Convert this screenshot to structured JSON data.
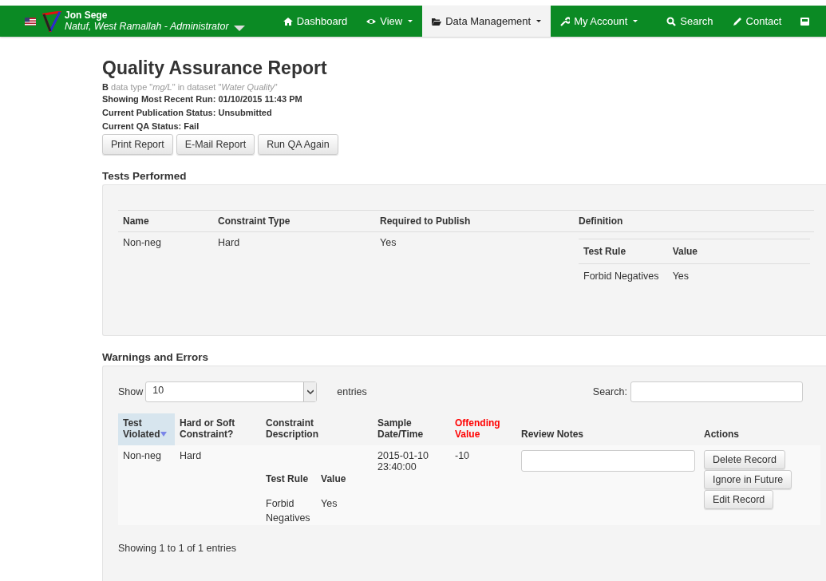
{
  "navbar": {
    "user": {
      "name": "Jon Sege",
      "subtitle": "Natuf, West Ramallah - Administrator"
    },
    "items": [
      {
        "label": "Dashboard",
        "dropdown": false,
        "selected": false
      },
      {
        "label": "View",
        "dropdown": true,
        "selected": false
      },
      {
        "label": "Data Management",
        "dropdown": true,
        "selected": true
      },
      {
        "label": "My Account",
        "dropdown": true,
        "selected": false
      },
      {
        "label": "Search",
        "dropdown": false,
        "selected": false
      },
      {
        "label": "Contact",
        "dropdown": false,
        "selected": false
      },
      {
        "dropdown": false,
        "selected": false
      }
    ]
  },
  "report": {
    "title": "Quality Assurance Report",
    "subtitle": "**B** data type \"*mg/L*\" in dataset \"*Water Quality*\"",
    "status_lines": [
      "Showing Most Recent Run: 01/10/2015 11:43 PM",
      "Current Publication Status: Unsubmitted",
      "Current QA Status: Fail"
    ],
    "buttons": [
      "Print Report",
      "E-Mail Report",
      "Run QA Again"
    ]
  },
  "tests": {
    "heading": "Tests Performed",
    "columns": [
      "Name",
      "Constraint Type",
      "Required to Publish",
      "Definition"
    ],
    "rows": [
      {
        "name": "Non-neg",
        "constraint_type": "Hard",
        "required": "Yes",
        "definition": {
          "columns": [
            "Test Rule",
            "Value"
          ],
          "rows": [
            [
              "Forbid Negatives",
              "Yes"
            ]
          ]
        }
      }
    ]
  },
  "warnings": {
    "heading": "Warnings and Errors",
    "show_label": "Show",
    "page_size": "10",
    "entries_label": "entries",
    "search_label": "Search:",
    "columns": [
      {
        "label": "Test Violated",
        "sorted": true,
        "alert": false
      },
      {
        "label": "Hard or Soft Constraint?",
        "sorted": false,
        "alert": false
      },
      {
        "label": "Constraint Description",
        "sorted": false,
        "alert": false
      },
      {
        "label": "Sample Date/Time",
        "sorted": false,
        "alert": false
      },
      {
        "label": "Offending Value",
        "sorted": false,
        "alert": true
      },
      {
        "label": "Review Notes",
        "sorted": false,
        "alert": false
      },
      {
        "label": "Actions",
        "sorted": false,
        "alert": false
      }
    ],
    "rows": [
      {
        "test": "Non-neg",
        "hardness": "Hard",
        "description": {
          "columns": [
            "Test Rule",
            "Value"
          ],
          "rows": [
            [
              "Forbid Negatives",
              "Yes"
            ]
          ]
        },
        "date": "2015-01-10 23:40:00",
        "value": "-10",
        "actions": [
          "Delete Record",
          "Ignore in Future",
          "Edit Record"
        ]
      }
    ],
    "footer": "Showing 1 to 1 of 1 entries"
  }
}
